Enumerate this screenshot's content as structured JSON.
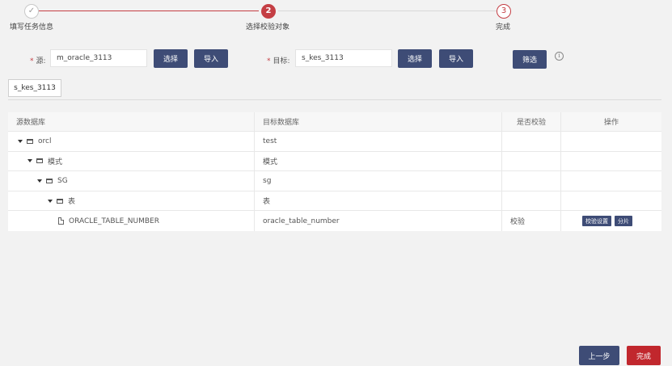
{
  "stepper": {
    "steps": [
      {
        "number": "",
        "label": "填写任务信息",
        "state": "done"
      },
      {
        "number": "2",
        "label": "选择校验对象",
        "state": "current"
      },
      {
        "number": "3",
        "label": "完成",
        "state": "todo"
      }
    ],
    "done_glyph": "✓"
  },
  "form": {
    "required_mark": "*",
    "source_label": "源:",
    "source_value": "m_oracle_3113",
    "target_label": "目标:",
    "target_value": "s_kes_3113",
    "select_label": "选择",
    "import_label": "导入",
    "filter_label": "筛选",
    "info_glyph": "i"
  },
  "tab": {
    "label": "s_kes_3113"
  },
  "table": {
    "headers": [
      "源数据库",
      "目标数据库",
      "是否校验",
      "操作"
    ],
    "rows": [
      {
        "source": "orcl",
        "target": "test",
        "check": "",
        "level": 0,
        "kind": "folder"
      },
      {
        "source": "模式",
        "target": "模式",
        "check": "",
        "level": 1,
        "kind": "folder"
      },
      {
        "source": "SG",
        "target": "sg",
        "check": "",
        "level": 2,
        "kind": "folder"
      },
      {
        "source": "表",
        "target": "表",
        "check": "",
        "level": 3,
        "kind": "folder"
      },
      {
        "source": "ORACLE_TABLE_NUMBER",
        "target": "oracle_table_number",
        "check": "校验",
        "level": 4,
        "kind": "file"
      }
    ],
    "action_buttons": [
      "校验设置",
      "分片"
    ]
  },
  "footer": {
    "prev_label": "上一步",
    "finish_label": "完成"
  },
  "colors": {
    "accent_red": "#c43e44",
    "navy": "#3e4c76",
    "finish_red": "#c1272d"
  }
}
